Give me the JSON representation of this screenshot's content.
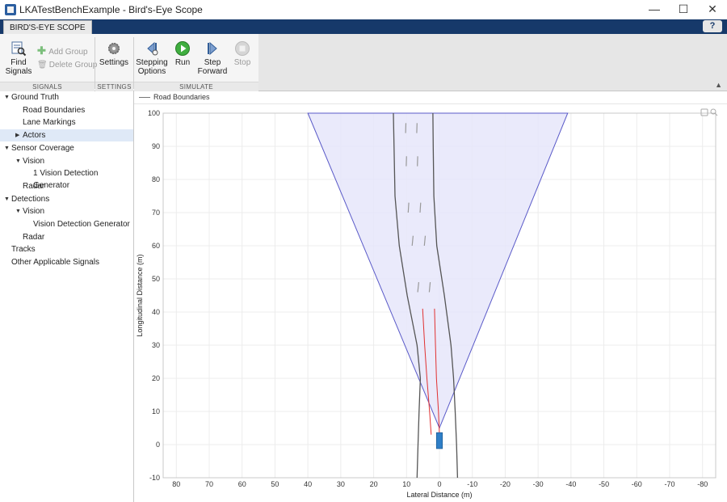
{
  "window": {
    "title": "LKATestBenchExample - Bird's-Eye Scope",
    "minimize": "—",
    "maximize": "☐",
    "close": "✕"
  },
  "ribbon": {
    "tab_label": "BIRD'S-EYE SCOPE",
    "help": "?"
  },
  "toolstrip": {
    "find_signals_l1": "Find",
    "find_signals_l2": "Signals",
    "add_group": "Add Group",
    "delete_group": "Delete Group",
    "settings": "Settings",
    "stepping_options_l1": "Stepping",
    "stepping_options_l2": "Options",
    "run": "Run",
    "step_forward_l1": "Step",
    "step_forward_l2": "Forward",
    "stop": "Stop",
    "section_signals": "SIGNALS",
    "section_settings": "SETTINGS",
    "section_simulate": "SIMULATE"
  },
  "tree": [
    {
      "label": "Ground Truth",
      "expanded": true,
      "level": 0
    },
    {
      "label": "Road Boundaries",
      "level": 1
    },
    {
      "label": "Lane Markings",
      "level": 1
    },
    {
      "label": "Actors",
      "level": 1,
      "expanded": false,
      "selected": true
    },
    {
      "label": "Sensor Coverage",
      "expanded": true,
      "level": 0
    },
    {
      "label": "Vision",
      "expanded": true,
      "level": 1
    },
    {
      "label": "1 Vision Detection Generator",
      "level": 2
    },
    {
      "label": "Radar",
      "level": 1
    },
    {
      "label": "Detections",
      "expanded": true,
      "level": 0
    },
    {
      "label": "Vision",
      "expanded": true,
      "level": 1
    },
    {
      "label": "Vision Detection Generator",
      "level": 2
    },
    {
      "label": "Radar",
      "level": 1
    },
    {
      "label": "Tracks",
      "level": 0
    },
    {
      "label": "Other Applicable Signals",
      "level": 0
    }
  ],
  "legend": {
    "label": "Road Boundaries"
  },
  "chart_data": {
    "type": "scatter",
    "xlabel": "Lateral Distance (m)",
    "ylabel": "Longitudinal Distance (m)",
    "xlim": [
      84,
      -84
    ],
    "ylim": [
      -10,
      100
    ],
    "x_ticks": [
      80,
      70,
      60,
      50,
      40,
      30,
      20,
      10,
      0,
      -10,
      -20,
      -30,
      -40,
      -50,
      -60,
      -70,
      -80
    ],
    "y_ticks": [
      100,
      90,
      80,
      70,
      60,
      50,
      40,
      30,
      20,
      10,
      0,
      -10
    ],
    "grid": true,
    "coverage_area": {
      "color": "#e6e6fa",
      "edge_color": "#5a5ac8",
      "apex": [
        0,
        5
      ],
      "far_left": [
        40,
        100
      ],
      "far_right": [
        -39,
        100
      ]
    },
    "road_boundaries": {
      "color": "#555555",
      "series": [
        {
          "points": [
            [
              6.8,
              -10
            ],
            [
              6.5,
              0
            ],
            [
              6.2,
              10
            ],
            [
              5.8,
              20
            ],
            [
              6.8,
              30
            ],
            [
              9.8,
              45
            ],
            [
              12.2,
              60
            ],
            [
              13.5,
              75
            ],
            [
              13.8,
              90
            ],
            [
              14,
              100
            ]
          ]
        },
        {
          "points": [
            [
              -5.5,
              -10
            ],
            [
              -5.2,
              0
            ],
            [
              -4.8,
              10
            ],
            [
              -4.3,
              20
            ],
            [
              -3.5,
              30
            ],
            [
              -1.5,
              45
            ],
            [
              0.8,
              60
            ],
            [
              1.7,
              75
            ],
            [
              1.9,
              90
            ],
            [
              2,
              100
            ]
          ]
        }
      ]
    },
    "lane_markings": {
      "color": "#999999",
      "segments": [
        [
          [
            10.2,
            97
          ],
          [
            10.3,
            94
          ]
        ],
        [
          [
            6.8,
            97
          ],
          [
            6.9,
            94
          ]
        ],
        [
          [
            10,
            87
          ],
          [
            10.1,
            84
          ]
        ],
        [
          [
            6.6,
            87
          ],
          [
            6.7,
            84
          ]
        ],
        [
          [
            9.3,
            73
          ],
          [
            9.5,
            70
          ]
        ],
        [
          [
            5.7,
            73
          ],
          [
            5.9,
            70
          ]
        ],
        [
          [
            8,
            63
          ],
          [
            8.3,
            60
          ]
        ],
        [
          [
            4.3,
            63
          ],
          [
            4.6,
            60
          ]
        ],
        [
          [
            6.3,
            49
          ],
          [
            6.6,
            46
          ]
        ],
        [
          [
            2.8,
            49
          ],
          [
            3.1,
            46
          ]
        ]
      ]
    },
    "detections": {
      "color": "#e03030",
      "series": [
        {
          "points": [
            [
              5.1,
              41
            ],
            [
              4.5,
              30
            ],
            [
              3.8,
              20
            ],
            [
              3,
              10
            ],
            [
              2.5,
              3
            ]
          ]
        },
        {
          "points": [
            [
              1.5,
              41
            ],
            [
              1.2,
              30
            ],
            [
              0.9,
              20
            ],
            [
              0.3,
              10
            ],
            [
              0,
              3
            ]
          ]
        }
      ]
    },
    "ego_vehicle": {
      "color": "#2f7fc7",
      "x_range": [
        -0.9,
        0.9
      ],
      "y_range": [
        -1.2,
        3.6
      ]
    }
  }
}
